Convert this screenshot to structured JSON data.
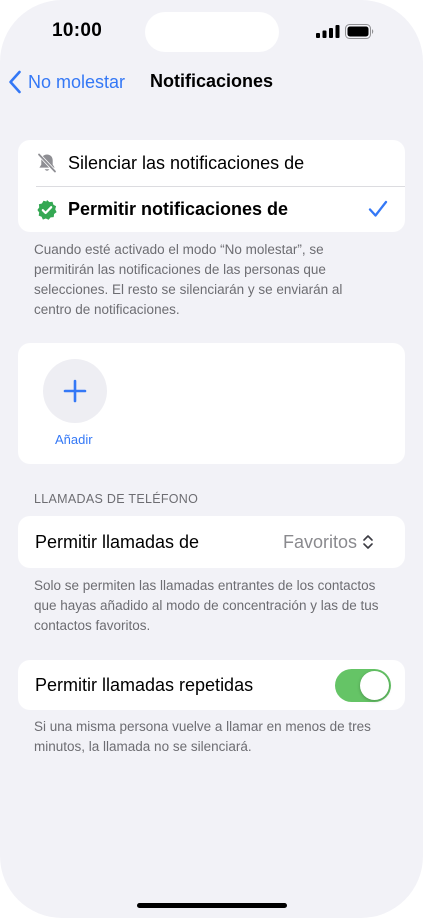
{
  "status_bar": {
    "time": "10:00",
    "signal_icon": "cellular-signal-icon",
    "battery_icon": "battery-icon"
  },
  "nav": {
    "back_label": "No molestar",
    "title": "Notificaciones"
  },
  "notifications_mode": {
    "options": [
      {
        "label": "Silenciar las notificaciones de",
        "icon": "bell-slash-icon",
        "selected": false
      },
      {
        "label": "Permitir notificaciones de",
        "icon": "checkmark-shield-icon",
        "selected": true
      }
    ],
    "footnote": "Cuando esté activado el modo “No molestar”, se permitirán las notificaciones de las personas que selecciones. El resto se silenciarán y se enviarán al centro de notificaciones."
  },
  "people": {
    "add_label": "Añadir"
  },
  "phone_calls": {
    "header": "LLAMADAS DE TELÉFONO",
    "allow_calls_label": "Permitir llamadas de",
    "allow_calls_value": "Favoritos",
    "footnote": "Solo se permiten las llamadas entrantes de los contactos que hayas añadido al modo de concentración y las de tus contactos favoritos.",
    "repeated_calls_label": "Permitir llamadas repetidas",
    "repeated_calls_enabled": true,
    "repeated_footnote": "Si una misma persona vuelve a llamar en menos de tres minutos, la llamada no se silenciará."
  },
  "colors": {
    "accent": "#3478f6",
    "toggle_on": "#65c466",
    "shield_green": "#34a853",
    "background": "#f2f2f7"
  }
}
